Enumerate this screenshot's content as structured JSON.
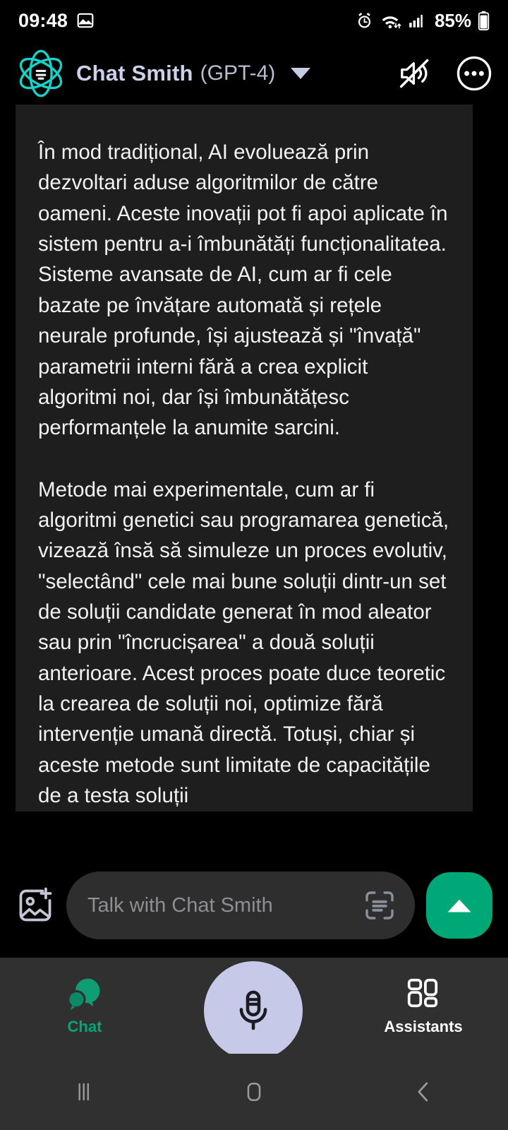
{
  "status_bar": {
    "time": "09:48",
    "battery_percent": "85%",
    "icons": [
      "image-icon",
      "alarm-icon",
      "wifi-icon",
      "signal-icon",
      "battery-icon"
    ]
  },
  "header": {
    "logo_icon": "atom-logo-icon",
    "title": "Chat Smith",
    "model": "(GPT-4)",
    "dropdown_icon": "chevron-down-icon",
    "mute_icon": "speaker-muted-icon",
    "more_icon": "more-options-icon",
    "accent_color": "#16d3c8",
    "title_color": "#ccd0e8"
  },
  "message": {
    "role": "assistant",
    "paragraphs": [
      "În mod tradițional, AI evoluează prin dezvoltari aduse algoritmilor de către oameni. Aceste inovații pot fi apoi aplicate în sistem pentru a-i îmbunătăți funcționalitatea. Sisteme avansate de AI, cum ar fi cele bazate pe învățare automată și rețele neurale profunde, își ajustează și \"învață\" parametrii interni fără a crea explicit algoritmi noi, dar își îmbunătățesc performanțele la anumite sarcini.",
      "Metode mai experimentale, cum ar fi algoritmi genetici sau programarea genetică, vizează însă să simuleze un proces evolutiv, \"selectând\" cele mai bune soluții dintr-un set de soluții candidate generat în mod aleator sau prin \"încrucișarea\" a două soluții anterioare. Acest proces poate duce teoretic la crearea de soluții noi, optimize fără intervenție umană directă. Totuși, chiar și aceste metode sunt limitate de capacitățile de a testa soluții"
    ],
    "bubble_color": "#1e1e1e",
    "text_color": "#f2f2f2"
  },
  "input_bar": {
    "add_image_icon": "add-image-icon",
    "placeholder": "Talk with Chat Smith",
    "value": "",
    "scan_icon": "scan-text-icon",
    "send_icon": "send-arrow-icon",
    "send_color": "#00a878"
  },
  "bottom_nav": {
    "items": [
      {
        "label": "Chat",
        "icon": "chat-bubbles-icon",
        "active": true
      },
      {
        "label": "Assistants",
        "icon": "grid-apps-icon",
        "active": false
      }
    ],
    "mic_icon": "microphone-icon",
    "active_color": "#00a878",
    "mic_bg_color": "#c6cae8"
  },
  "system_nav": {
    "recents_icon": "recents-icon",
    "home_icon": "home-icon",
    "back_icon": "back-icon"
  }
}
